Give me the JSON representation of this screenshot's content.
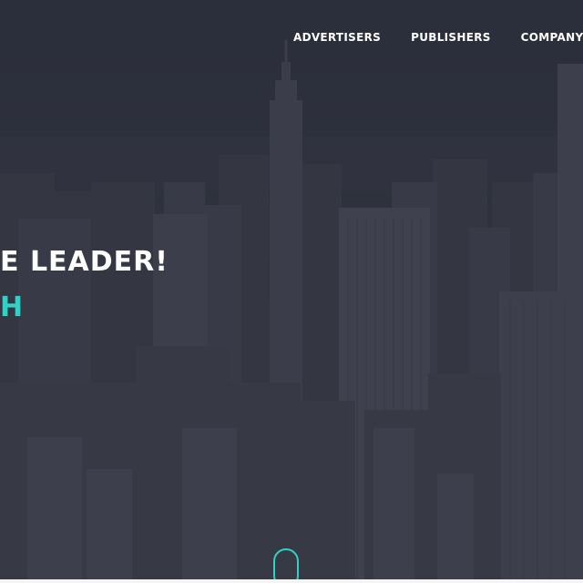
{
  "nav": {
    "items": [
      {
        "label": "ADVERTISERS"
      },
      {
        "label": "PUBLISHERS"
      },
      {
        "label": "COMPANY"
      }
    ]
  },
  "hero": {
    "headline": "E LEADER!",
    "subheadline": "H"
  },
  "colors": {
    "accent": "#2ed3c8",
    "overlay": "#2f323c",
    "text": "#ffffff"
  },
  "icons": {
    "scroll": "mouse-scroll-icon"
  }
}
